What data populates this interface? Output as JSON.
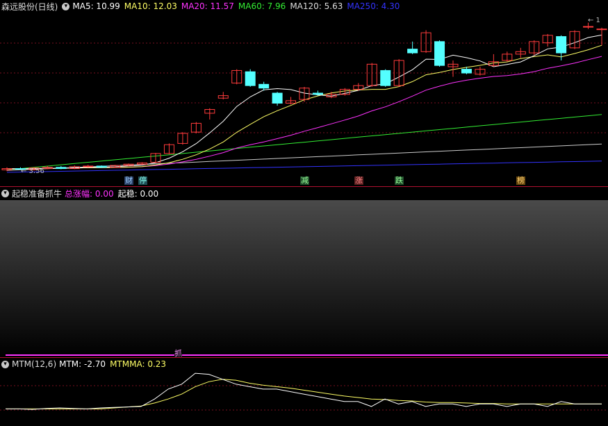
{
  "main_pane": {
    "title": "森远股份(日线)",
    "indicators": [
      {
        "label": "MA5: 10.99",
        "color": "#ffffff"
      },
      {
        "label": "MA10: 12.03",
        "color": "#ffff66"
      },
      {
        "label": "MA20: 11.57",
        "color": "#ff33ff"
      },
      {
        "label": "MA60: 7.96",
        "color": "#33ee33"
      },
      {
        "label": "MA120: 5.63",
        "color": "#dddddd"
      },
      {
        "label": "MA250: 4.30",
        "color": "#3333ff"
      }
    ],
    "low_price_label": "← 3.56",
    "high_price_label": "← 1",
    "signals": [
      {
        "text": "财",
        "bg": "#2a3f66",
        "color": "#9ed0ff"
      },
      {
        "text": "停",
        "bg": "#1f4d55",
        "color": "#88ffee"
      },
      {
        "text": "减",
        "bg": "#1f4d2a",
        "color": "#99ff99"
      },
      {
        "text": "涨",
        "bg": "#5a1f1f",
        "color": "#ff8888"
      },
      {
        "text": "跌",
        "bg": "#1f4d2a",
        "color": "#99ff99"
      },
      {
        "text": "榜",
        "bg": "#6a4a10",
        "color": "#ffd070"
      }
    ]
  },
  "mid_pane": {
    "title": "起稳准备抓牛",
    "indicators": [
      {
        "label": "总涨幅: 0.00",
        "color": "#ff33ff"
      },
      {
        "label": "起稳: 0.00",
        "color": "#ffffff"
      }
    ],
    "marker": "抓"
  },
  "bottom_pane": {
    "title": "MTM(12,6)",
    "indicators": [
      {
        "label": "MTM: -2.70",
        "color": "#ffffff"
      },
      {
        "label": "MTMMA: 0.23",
        "color": "#ffff66"
      }
    ]
  },
  "chart_data": {
    "type": "candlestick",
    "candles": [
      {
        "o": 3.6,
        "c": 3.7,
        "h": 3.8,
        "l": 3.5
      },
      {
        "o": 3.7,
        "c": 3.65,
        "h": 3.8,
        "l": 3.6
      },
      {
        "o": 3.6,
        "c": 3.75,
        "h": 3.8,
        "l": 3.55
      },
      {
        "o": 3.7,
        "c": 3.8,
        "h": 3.9,
        "l": 3.65
      },
      {
        "o": 3.8,
        "c": 3.7,
        "h": 3.9,
        "l": 3.65
      },
      {
        "o": 3.7,
        "c": 3.85,
        "h": 3.95,
        "l": 3.65
      },
      {
        "o": 3.85,
        "c": 3.9,
        "h": 4.0,
        "l": 3.8
      },
      {
        "o": 3.9,
        "c": 3.8,
        "h": 3.95,
        "l": 3.75
      },
      {
        "o": 3.8,
        "c": 3.95,
        "h": 4.0,
        "l": 3.75
      },
      {
        "o": 3.95,
        "c": 4.05,
        "h": 4.1,
        "l": 3.9
      },
      {
        "o": 4.05,
        "c": 4.15,
        "h": 4.2,
        "l": 4.0
      },
      {
        "o": 4.2,
        "c": 4.9,
        "h": 4.95,
        "l": 4.15
      },
      {
        "o": 4.9,
        "c": 5.6,
        "h": 5.7,
        "l": 4.85
      },
      {
        "o": 5.7,
        "c": 6.5,
        "h": 6.6,
        "l": 5.6
      },
      {
        "o": 6.6,
        "c": 7.3,
        "h": 7.4,
        "l": 6.5
      },
      {
        "o": 8.1,
        "c": 8.4,
        "h": 8.5,
        "l": 7.6
      },
      {
        "o": 9.3,
        "c": 9.5,
        "h": 9.8,
        "l": 9.2
      },
      {
        "o": 10.5,
        "c": 11.5,
        "h": 11.6,
        "l": 10.4
      },
      {
        "o": 11.4,
        "c": 10.3,
        "h": 11.6,
        "l": 10.2
      },
      {
        "o": 10.4,
        "c": 10.1,
        "h": 10.6,
        "l": 9.9
      },
      {
        "o": 9.7,
        "c": 8.9,
        "h": 9.8,
        "l": 8.7
      },
      {
        "o": 8.9,
        "c": 9.1,
        "h": 9.4,
        "l": 8.8
      },
      {
        "o": 9.2,
        "c": 10.1,
        "h": 10.2,
        "l": 9.0
      },
      {
        "o": 9.7,
        "c": 9.6,
        "h": 9.9,
        "l": 9.5
      },
      {
        "o": 9.4,
        "c": 9.6,
        "h": 9.8,
        "l": 9.3
      },
      {
        "o": 9.6,
        "c": 10.0,
        "h": 10.1,
        "l": 9.5
      },
      {
        "o": 10.0,
        "c": 10.3,
        "h": 10.5,
        "l": 9.9
      },
      {
        "o": 10.3,
        "c": 12.0,
        "h": 12.1,
        "l": 10.2
      },
      {
        "o": 11.5,
        "c": 10.3,
        "h": 11.6,
        "l": 10.2
      },
      {
        "o": 10.3,
        "c": 12.3,
        "h": 12.4,
        "l": 10.2
      },
      {
        "o": 13.2,
        "c": 12.9,
        "h": 13.8,
        "l": 12.8
      },
      {
        "o": 13.0,
        "c": 14.5,
        "h": 14.7,
        "l": 12.9
      },
      {
        "o": 13.8,
        "c": 11.9,
        "h": 13.9,
        "l": 11.8
      },
      {
        "o": 11.8,
        "c": 12.0,
        "h": 12.3,
        "l": 11.0
      },
      {
        "o": 11.6,
        "c": 11.3,
        "h": 11.8,
        "l": 11.2
      },
      {
        "o": 11.2,
        "c": 11.6,
        "h": 11.8,
        "l": 11.1
      },
      {
        "o": 11.9,
        "c": 12.2,
        "h": 12.8,
        "l": 11.8
      },
      {
        "o": 12.3,
        "c": 12.8,
        "h": 13.0,
        "l": 12.2
      },
      {
        "o": 12.8,
        "c": 13.0,
        "h": 13.3,
        "l": 12.5
      },
      {
        "o": 12.9,
        "c": 13.8,
        "h": 13.9,
        "l": 12.7
      },
      {
        "o": 13.7,
        "c": 14.3,
        "h": 14.4,
        "l": 13.4
      },
      {
        "o": 14.2,
        "c": 12.9,
        "h": 14.3,
        "l": 12.3
      },
      {
        "o": 13.3,
        "c": 14.6,
        "h": 14.7,
        "l": 13.2
      },
      {
        "o": 15.0,
        "c": 15.0,
        "h": 15.3,
        "l": 14.8
      },
      {
        "o": 14.8,
        "c": 14.8,
        "h": 14.9,
        "l": 13.5
      }
    ],
    "mtm": [
      2,
      2,
      1.9,
      2.1,
      2.2,
      2.1,
      2.0,
      2.2,
      2.3,
      2.4,
      2.5,
      4,
      6,
      7,
      9.2,
      9,
      8,
      7,
      6.5,
      6,
      6,
      5.5,
      5,
      4.5,
      4,
      3.5,
      3.5,
      2.5,
      4,
      3,
      3.5,
      2.5,
      3,
      3,
      2.5,
      3,
      3,
      2.5,
      3,
      3,
      2.5,
      3.5,
      3,
      3,
      3
    ],
    "mtmma": [
      2,
      2,
      2,
      2,
      2,
      2,
      2,
      2,
      2.2,
      2.4,
      2.6,
      3.2,
      4,
      5,
      6.5,
      7.5,
      8,
      7.8,
      7.2,
      6.8,
      6.5,
      6.2,
      5.8,
      5.4,
      5,
      4.6,
      4.3,
      4,
      3.9,
      3.7,
      3.6,
      3.4,
      3.3,
      3.3,
      3.2,
      3.1,
      3.1,
      3.0,
      3.0,
      3.0,
      3.0,
      3.0,
      3.0,
      3.0,
      3.0
    ]
  }
}
